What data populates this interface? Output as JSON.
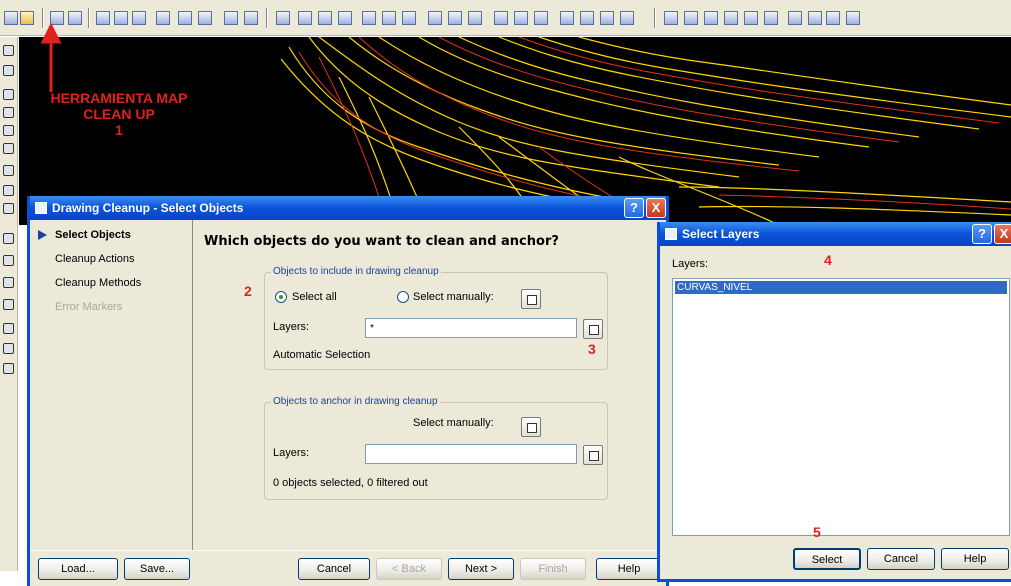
{
  "toolbar": {
    "icons": [
      "map-cleanup-icon",
      "drawing-icon",
      "layer-icon",
      "properties-icon",
      "query-icon",
      "render-icon",
      "view-icon",
      "print-icon",
      "globe-icon",
      "network-icon",
      "map-tool-icon",
      "zoom-icon",
      "pan-icon",
      "table-icon",
      "data-icon",
      "attach-icon",
      "layout-icon",
      "export-icon",
      "import-icon",
      "plot-icon",
      "grid-icon",
      "topology-icon",
      "analysis-icon",
      "snap-icon",
      "lock-icon",
      "unlock-icon"
    ]
  },
  "annotations": {
    "tool_label_1": "HERRAMIENTA MAP",
    "tool_label_2": "CLEAN UP",
    "step1": "1",
    "step2": "2",
    "step3": "3",
    "step4": "4",
    "step5": "5",
    "color": "#e0211d"
  },
  "main_dialog": {
    "title": "Drawing Cleanup - Select Objects",
    "help": "?",
    "close": "X",
    "sidebar": {
      "items": [
        {
          "label": "Select Objects",
          "active": true
        },
        {
          "label": "Cleanup Actions",
          "active": false
        },
        {
          "label": "Cleanup Methods",
          "active": false
        },
        {
          "label": "Error Markers",
          "active": false,
          "disabled": true
        }
      ]
    },
    "heading": "Which objects do you want to clean and anchor?",
    "include_group": {
      "title": "Objects to include in drawing cleanup",
      "select_all": "Select all",
      "select_manually": "Select manually:",
      "layers_label": "Layers:",
      "layers_value": "*",
      "automatic": "Automatic Selection"
    },
    "anchor_group": {
      "title": "Objects to anchor in drawing cleanup",
      "select_manually": "Select manually:",
      "layers_label": "Layers:",
      "layers_value": "",
      "status": "0 objects selected, 0 filtered out"
    },
    "buttons": {
      "load": "Load...",
      "save": "Save...",
      "cancel": "Cancel",
      "back": "< Back",
      "next": "Next >",
      "finish": "Finish",
      "help": "Help"
    }
  },
  "layers_dialog": {
    "title": "Select Layers",
    "help": "?",
    "close": "X",
    "layers_label": "Layers:",
    "items": [
      "CURVAS_NIVEL"
    ],
    "buttons": {
      "select": "Select",
      "cancel": "Cancel",
      "help": "Help"
    }
  },
  "colors": {
    "titlebar": "#0a52d9",
    "dialog_bg": "#ece9d8",
    "drawing_bg": "#000000",
    "contour_primary": "#ffd800",
    "contour_secondary": "#e03020",
    "selection": "#316ac5"
  }
}
